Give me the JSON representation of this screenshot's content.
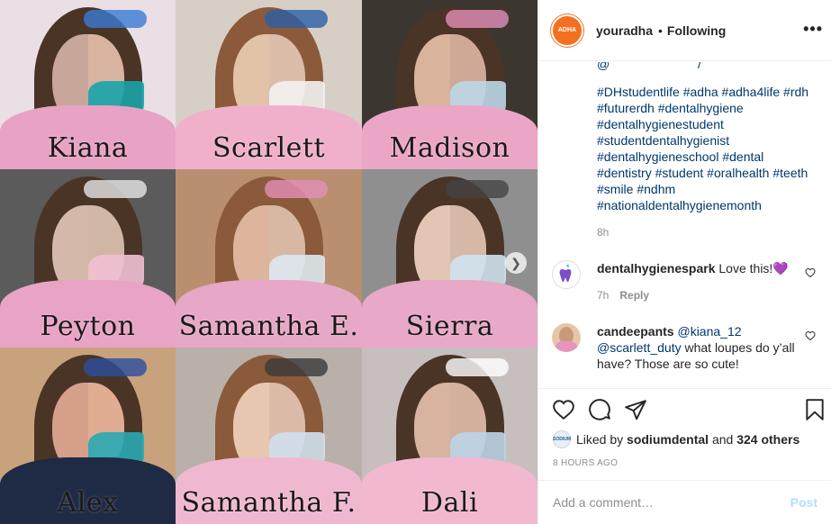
{
  "post": {
    "grid": [
      {
        "name": "Kiana",
        "left": "#c9a69a",
        "right": "#d8b4a0",
        "bg": "#e9dfe4",
        "shirt": "#e8a2c4",
        "mask": "#1aa3a8",
        "shield": "#3a7bd5"
      },
      {
        "name": "Scarlett",
        "left": "#e2c3a7",
        "right": "#dbbda9",
        "bg": "#d7cfc6",
        "shirt": "#f0b0cc",
        "mask": "#f2f2f2",
        "shield": "#2a5fa8"
      },
      {
        "name": "Madison",
        "left": "#d9b39c",
        "right": "#cfa996",
        "bg": "#3c3631",
        "shirt": "#eba6c6",
        "mask": "#bcd6e8",
        "shield": "#e48fb9"
      },
      {
        "name": "Peyton",
        "left": "#d4b8a9",
        "right": "#cfb6a5",
        "bg": "#5b5b5b",
        "shirt": "#e9a3c5",
        "mask": "#f1c1d4",
        "shield": "#e6e6e6"
      },
      {
        "name": "Samantha E.",
        "left": "#dcb59c",
        "right": "#d9b8a3",
        "bg": "#b98f6f",
        "shirt": "#e7a7c6",
        "mask": "#dde8f0",
        "shield": "#e48fb9"
      },
      {
        "name": "Sierra",
        "left": "#e2c5b3",
        "right": "#d6b8a6",
        "bg": "#8f8f8f",
        "shirt": "#e8a8c8",
        "mask": "#cfe3ef",
        "shield": "#444444"
      },
      {
        "name": "Alex",
        "left": "#d6a08a",
        "right": "#e1ad92",
        "bg": "#c8a27c",
        "shirt": "#1f2a44",
        "mask": "#2aa7b3",
        "shield": "#2a4fa0"
      },
      {
        "name": "Samantha F.",
        "left": "#e8c7b0",
        "right": "#dbbaa8",
        "bg": "#b9b0aa",
        "shirt": "#f0b8d0",
        "mask": "#cfe0ee",
        "shield": "#3a3a3a"
      },
      {
        "name": "Dali",
        "left": "#d8b3a0",
        "right": "#d4b09e",
        "bg": "#c6bfbd",
        "shirt": "#f1b8d0",
        "mask": "#bcd4e8",
        "shield": "#ffffff"
      }
    ],
    "next_icon": "chevron-right-icon"
  },
  "header": {
    "username": "youradha",
    "separator": "•",
    "follow_status": "Following",
    "more": "•••",
    "avatar_text": "ADHA"
  },
  "caption": {
    "hashtags": "#DHstudentlife #adha #adha4life #rdh #futurerdh #dentalhygiene #dentalhygienestudent #studentdentalhygienist #dentalhygieneschool #dental #dentistry #student #oralhealth #teeth #smile #ndhm #nationaldentalhygienemonth",
    "time": "8h"
  },
  "comments": [
    {
      "username": "dentalhygienespark",
      "text": "Love this!",
      "emoji": "💜",
      "time": "7h",
      "reply": "Reply"
    },
    {
      "username": "candeepants",
      "mention1": "@kiana_12",
      "mention2": "@scarlett_duty",
      "text": "what loupes do y’all have? Those are so cute!"
    }
  ],
  "actions": {
    "like_icon": "heart-icon",
    "comment_icon": "comment-icon",
    "share_icon": "send-icon",
    "save_icon": "bookmark-icon"
  },
  "likes": {
    "prefix": "Liked by",
    "user": "sodiumdental",
    "conj": "and",
    "others": "324 others",
    "avatar_text": "SODIUM"
  },
  "posted_ago": "8 HOURS AGO",
  "add_comment": {
    "placeholder": "Add a comment…",
    "post_label": "Post"
  }
}
